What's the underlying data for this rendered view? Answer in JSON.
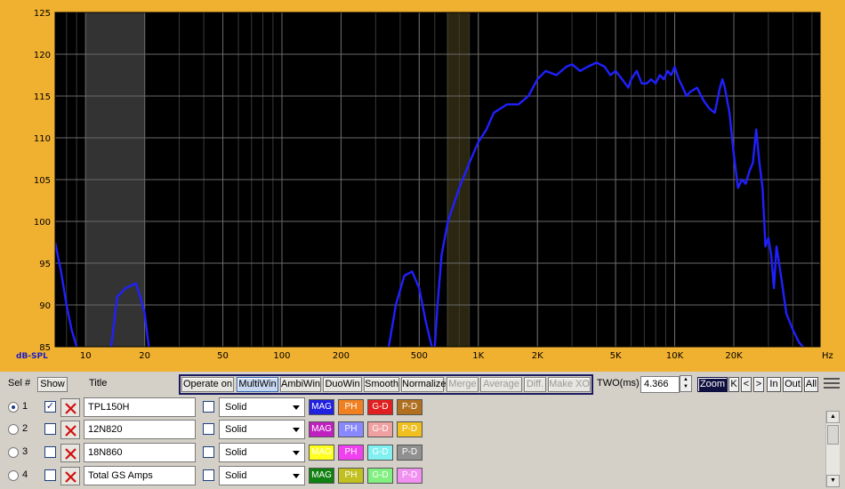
{
  "chart_data": {
    "type": "line",
    "ylabel": "dB-SPL",
    "xlabel": "Hz",
    "x_scale": "log",
    "xlim": [
      7,
      55000
    ],
    "ylim": [
      85,
      125
    ],
    "y_ticks": [
      85,
      90,
      95,
      100,
      105,
      110,
      115,
      120,
      125
    ],
    "x_ticks": [
      {
        "value": 10,
        "label": "10"
      },
      {
        "value": 20,
        "label": "20"
      },
      {
        "value": 50,
        "label": "50"
      },
      {
        "value": 100,
        "label": "100"
      },
      {
        "value": 200,
        "label": "200"
      },
      {
        "value": 500,
        "label": "500"
      },
      {
        "value": 1000,
        "label": "1K"
      },
      {
        "value": 2000,
        "label": "2K"
      },
      {
        "value": 5000,
        "label": "5K"
      },
      {
        "value": 10000,
        "label": "10K"
      },
      {
        "value": 20000,
        "label": "20K"
      }
    ],
    "shaded_bands": [
      {
        "from": 10,
        "to": 20,
        "color": "#333333"
      },
      {
        "from": 690,
        "to": 900,
        "color": "#2a2610"
      }
    ],
    "grid": true,
    "background": "#000000",
    "frame_color": "#f0b030",
    "series": [
      {
        "color": "#2020ff",
        "segments": [
          [
            [
              7,
              97.5
            ],
            [
              7.5,
              94
            ],
            [
              8,
              90
            ],
            [
              8.5,
              87
            ],
            [
              9,
              85
            ]
          ],
          [
            [
              13.5,
              85
            ],
            [
              14.5,
              91
            ],
            [
              16,
              92
            ],
            [
              18,
              92.6
            ],
            [
              19,
              91
            ],
            [
              20,
              89
            ],
            [
              21,
              85
            ]
          ],
          [
            [
              350,
              85
            ],
            [
              380,
              90
            ],
            [
              420,
              93.5
            ],
            [
              460,
              94
            ],
            [
              500,
              92
            ],
            [
              540,
              88
            ],
            [
              580,
              85
            ]
          ],
          [
            [
              600,
              85
            ],
            [
              620,
              90
            ],
            [
              650,
              96
            ],
            [
              700,
              100
            ],
            [
              800,
              104
            ],
            [
              900,
              107
            ],
            [
              1000,
              109.5
            ],
            [
              1100,
              111
            ],
            [
              1200,
              113
            ],
            [
              1400,
              114
            ],
            [
              1600,
              114
            ],
            [
              1800,
              115
            ],
            [
              2000,
              117
            ],
            [
              2200,
              118
            ],
            [
              2500,
              117.5
            ],
            [
              2800,
              118.5
            ],
            [
              3000,
              118.8
            ],
            [
              3300,
              118
            ],
            [
              3600,
              118.5
            ],
            [
              4000,
              119
            ],
            [
              4400,
              118.5
            ],
            [
              4700,
              117.5
            ],
            [
              5000,
              118
            ],
            [
              5400,
              117
            ],
            [
              5800,
              116
            ],
            [
              6000,
              117
            ],
            [
              6400,
              118
            ],
            [
              6800,
              116.5
            ],
            [
              7200,
              116.5
            ],
            [
              7600,
              117
            ],
            [
              8000,
              116.5
            ],
            [
              8400,
              117.5
            ],
            [
              8800,
              117
            ],
            [
              9200,
              118
            ],
            [
              9600,
              117.5
            ],
            [
              10000,
              118.5
            ],
            [
              10500,
              117
            ],
            [
              11000,
              116
            ],
            [
              11500,
              115
            ],
            [
              12000,
              115.5
            ],
            [
              13000,
              116
            ],
            [
              14000,
              114.5
            ],
            [
              15000,
              113.5
            ],
            [
              16000,
              113
            ],
            [
              17000,
              116
            ],
            [
              17500,
              117
            ],
            [
              18000,
              116
            ],
            [
              19000,
              113
            ],
            [
              20000,
              108
            ],
            [
              21000,
              104
            ],
            [
              22000,
              105
            ],
            [
              23000,
              104.5
            ],
            [
              24000,
              106
            ],
            [
              25000,
              107
            ],
            [
              26000,
              111
            ],
            [
              27000,
              107
            ],
            [
              28000,
              104
            ],
            [
              29000,
              97
            ],
            [
              30000,
              98
            ],
            [
              31000,
              96
            ],
            [
              32000,
              92
            ],
            [
              33000,
              97
            ],
            [
              34000,
              95
            ],
            [
              35000,
              93
            ],
            [
              37000,
              89
            ],
            [
              40000,
              87
            ],
            [
              43000,
              85.5
            ],
            [
              45000,
              85
            ]
          ]
        ]
      }
    ]
  },
  "toolbar": {
    "sel_label": "Sel #",
    "show_label": "Show",
    "title_header": "Title",
    "operate_label": "Operate on",
    "view_buttons": [
      "MultiWin",
      "AmbiWin",
      "DuoWin",
      "Smooth",
      "Normalize"
    ],
    "action_buttons": [
      "Merge",
      "Average",
      "Diff.",
      "Make XO"
    ],
    "two_label": "TWO(ms)",
    "two_value": "4.366",
    "zoom_label": "Zoom",
    "zoom_buttons": [
      "K",
      "<",
      ">",
      "In",
      "Out",
      "All"
    ]
  },
  "rows": [
    {
      "num": "1",
      "selected": true,
      "show": true,
      "title": "TPL150H",
      "line_style": "Solid",
      "chips": [
        {
          "label": "MAG",
          "bg": "#2020e0",
          "fg": "#ffffff"
        },
        {
          "label": "PH",
          "bg": "#f08020",
          "fg": "#ffffff"
        },
        {
          "label": "G-D",
          "bg": "#e02020",
          "fg": "#ffffff"
        },
        {
          "label": "P-D",
          "bg": "#b07020",
          "fg": "#ffffff"
        }
      ]
    },
    {
      "num": "2",
      "selected": false,
      "show": false,
      "title": "12N820",
      "line_style": "Solid",
      "chips": [
        {
          "label": "MAG",
          "bg": "#c020c0",
          "fg": "#ffffff"
        },
        {
          "label": "PH",
          "bg": "#8888ff",
          "fg": "#ffffff"
        },
        {
          "label": "G-D",
          "bg": "#f0a0a0",
          "fg": "#ffffff"
        },
        {
          "label": "P-D",
          "bg": "#f0c020",
          "fg": "#ffffff"
        }
      ]
    },
    {
      "num": "3",
      "selected": false,
      "show": false,
      "title": "18N860",
      "line_style": "Solid",
      "chips": [
        {
          "label": "MAG",
          "bg": "#ffff20",
          "fg": "#ffffff"
        },
        {
          "label": "PH",
          "bg": "#f040f0",
          "fg": "#ffffff"
        },
        {
          "label": "G-D",
          "bg": "#80f0f0",
          "fg": "#ffffff"
        },
        {
          "label": "P-D",
          "bg": "#909090",
          "fg": "#ffffff"
        }
      ]
    },
    {
      "num": "4",
      "selected": false,
      "show": false,
      "title": "Total GS Amps",
      "line_style": "Solid",
      "chips": [
        {
          "label": "MAG",
          "bg": "#108010",
          "fg": "#ffffff"
        },
        {
          "label": "PH",
          "bg": "#c0c020",
          "fg": "#ffffff"
        },
        {
          "label": "G-D",
          "bg": "#80f080",
          "fg": "#ffffff"
        },
        {
          "label": "P-D",
          "bg": "#f090f0",
          "fg": "#ffffff"
        }
      ]
    }
  ]
}
